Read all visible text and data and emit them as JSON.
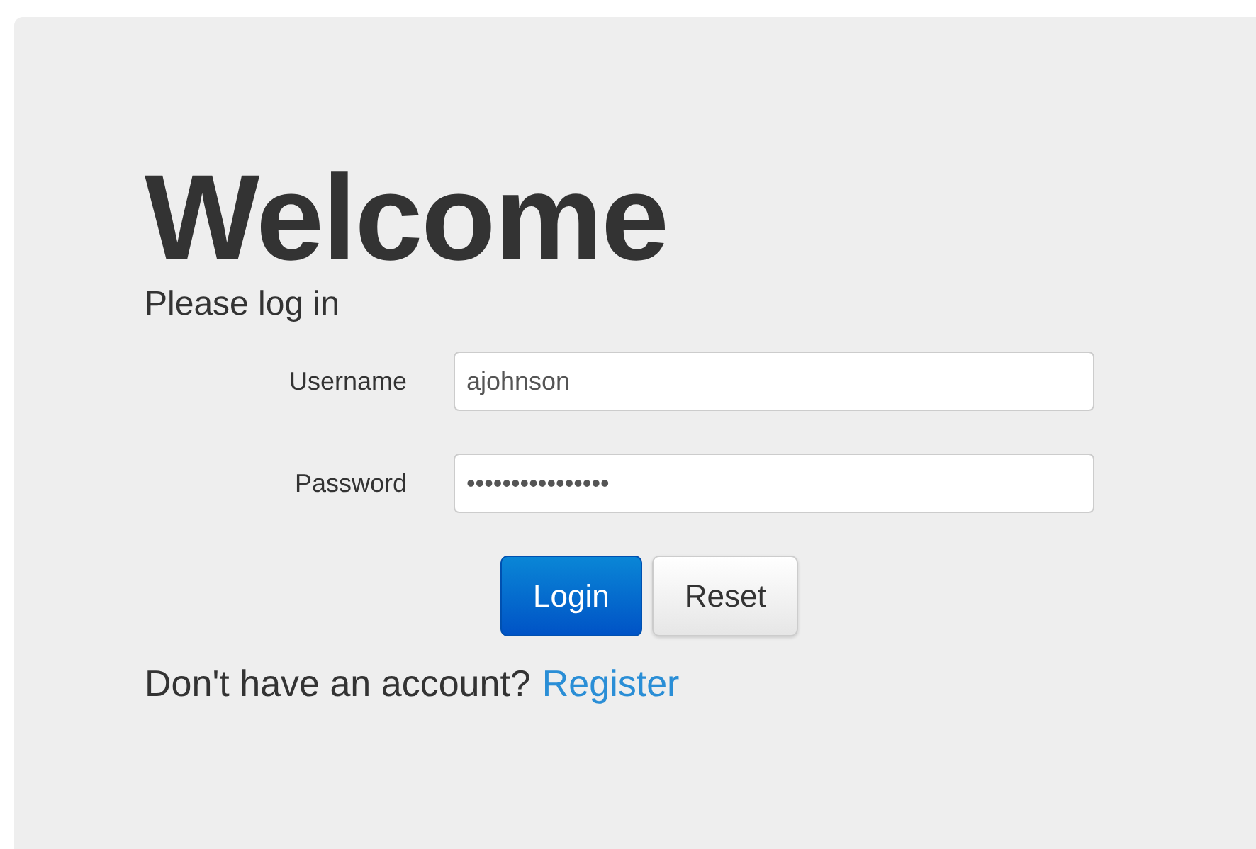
{
  "heading": "Welcome",
  "subheading": "Please log in",
  "fields": [
    {
      "label": "Username",
      "value": "ajohnson"
    },
    {
      "label": "Password",
      "value": "••••••••••••••••"
    }
  ],
  "buttons": [
    {
      "label": "Login",
      "kind": "primary"
    },
    {
      "label": "Reset",
      "kind": "default"
    }
  ],
  "register_prompt": {
    "text": "Don't have an account?",
    "link": "Register"
  }
}
